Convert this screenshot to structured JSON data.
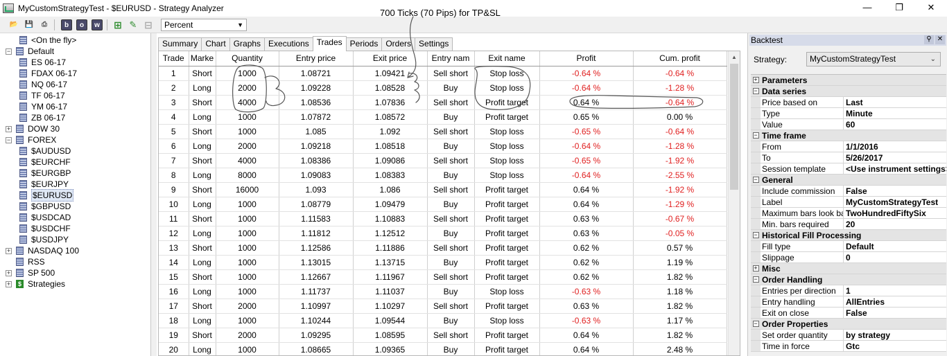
{
  "window": {
    "title": "MyCustomStrategyTest - $EURUSD - Strategy Analyzer"
  },
  "toolbar": {
    "bold_b": "b",
    "bold_o": "o",
    "bold_w": "w",
    "display_mode": "Percent"
  },
  "tree": {
    "items": [
      {
        "label": "<On the fly>",
        "level": 1,
        "expander": ""
      },
      {
        "label": "Default",
        "level": 0,
        "expander": "−"
      },
      {
        "label": "ES 06-17",
        "level": 1,
        "expander": ""
      },
      {
        "label": "FDAX 06-17",
        "level": 1,
        "expander": ""
      },
      {
        "label": "NQ 06-17",
        "level": 1,
        "expander": ""
      },
      {
        "label": "TF 06-17",
        "level": 1,
        "expander": ""
      },
      {
        "label": "YM 06-17",
        "level": 1,
        "expander": ""
      },
      {
        "label": "ZB 06-17",
        "level": 1,
        "expander": ""
      },
      {
        "label": "DOW 30",
        "level": 0,
        "expander": "+"
      },
      {
        "label": "FOREX",
        "level": 0,
        "expander": "−"
      },
      {
        "label": "$AUDUSD",
        "level": 1,
        "expander": ""
      },
      {
        "label": "$EURCHF",
        "level": 1,
        "expander": ""
      },
      {
        "label": "$EURGBP",
        "level": 1,
        "expander": ""
      },
      {
        "label": "$EURJPY",
        "level": 1,
        "expander": ""
      },
      {
        "label": "$EURUSD",
        "level": 1,
        "expander": "",
        "selected": true
      },
      {
        "label": "$GBPUSD",
        "level": 1,
        "expander": ""
      },
      {
        "label": "$USDCAD",
        "level": 1,
        "expander": ""
      },
      {
        "label": "$USDCHF",
        "level": 1,
        "expander": ""
      },
      {
        "label": "$USDJPY",
        "level": 1,
        "expander": ""
      },
      {
        "label": "NASDAQ 100",
        "level": 0,
        "expander": "+"
      },
      {
        "label": "RSS",
        "level": 0,
        "expander": ""
      },
      {
        "label": "SP 500",
        "level": 0,
        "expander": "+"
      },
      {
        "label": "Strategies",
        "level": 0,
        "expander": "+",
        "icon": "strategy"
      }
    ]
  },
  "tabs": [
    {
      "label": "Summary"
    },
    {
      "label": "Chart"
    },
    {
      "label": "Graphs"
    },
    {
      "label": "Executions"
    },
    {
      "label": "Trades",
      "active": true
    },
    {
      "label": "Periods"
    },
    {
      "label": "Orders"
    },
    {
      "label": "Settings"
    }
  ],
  "grid": {
    "columns": [
      "Trade",
      "Marke",
      "Quantity",
      "Entry price",
      "Exit price",
      "Entry nam",
      "Exit name",
      "Profit",
      "Cum. profit"
    ],
    "rows": [
      [
        "1",
        "Short",
        "1000",
        "1.08721",
        "1.09421",
        "Sell short",
        "Stop loss",
        "-0.64 %",
        "-0.64 %"
      ],
      [
        "2",
        "Long",
        "2000",
        "1.09228",
        "1.08528",
        "Buy",
        "Stop loss",
        "-0.64 %",
        "-1.28 %"
      ],
      [
        "3",
        "Short",
        "4000",
        "1.08536",
        "1.07836",
        "Sell short",
        "Profit target",
        "0.64 %",
        "-0.64 %"
      ],
      [
        "4",
        "Long",
        "1000",
        "1.07872",
        "1.08572",
        "Buy",
        "Profit target",
        "0.65 %",
        "0.00 %"
      ],
      [
        "5",
        "Short",
        "1000",
        "1.085",
        "1.092",
        "Sell short",
        "Stop loss",
        "-0.65 %",
        "-0.64 %"
      ],
      [
        "6",
        "Long",
        "2000",
        "1.09218",
        "1.08518",
        "Buy",
        "Stop loss",
        "-0.64 %",
        "-1.28 %"
      ],
      [
        "7",
        "Short",
        "4000",
        "1.08386",
        "1.09086",
        "Sell short",
        "Stop loss",
        "-0.65 %",
        "-1.92 %"
      ],
      [
        "8",
        "Long",
        "8000",
        "1.09083",
        "1.08383",
        "Buy",
        "Stop loss",
        "-0.64 %",
        "-2.55 %"
      ],
      [
        "9",
        "Short",
        "16000",
        "1.093",
        "1.086",
        "Sell short",
        "Profit target",
        "0.64 %",
        "-1.92 %"
      ],
      [
        "10",
        "Long",
        "1000",
        "1.08779",
        "1.09479",
        "Buy",
        "Profit target",
        "0.64 %",
        "-1.29 %"
      ],
      [
        "11",
        "Short",
        "1000",
        "1.11583",
        "1.10883",
        "Sell short",
        "Profit target",
        "0.63 %",
        "-0.67 %"
      ],
      [
        "12",
        "Long",
        "1000",
        "1.11812",
        "1.12512",
        "Buy",
        "Profit target",
        "0.63 %",
        "-0.05 %"
      ],
      [
        "13",
        "Short",
        "1000",
        "1.12586",
        "1.11886",
        "Sell short",
        "Profit target",
        "0.62 %",
        "0.57 %"
      ],
      [
        "14",
        "Long",
        "1000",
        "1.13015",
        "1.13715",
        "Buy",
        "Profit target",
        "0.62 %",
        "1.19 %"
      ],
      [
        "15",
        "Short",
        "1000",
        "1.12667",
        "1.11967",
        "Sell short",
        "Profit target",
        "0.62 %",
        "1.82 %"
      ],
      [
        "16",
        "Long",
        "1000",
        "1.11737",
        "1.11037",
        "Buy",
        "Stop loss",
        "-0.63 %",
        "1.18 %"
      ],
      [
        "17",
        "Short",
        "2000",
        "1.10997",
        "1.10297",
        "Sell short",
        "Profit target",
        "0.63 %",
        "1.82 %"
      ],
      [
        "18",
        "Long",
        "1000",
        "1.10244",
        "1.09544",
        "Buy",
        "Stop loss",
        "-0.63 %",
        "1.17 %"
      ],
      [
        "19",
        "Short",
        "2000",
        "1.09295",
        "1.08595",
        "Sell short",
        "Profit target",
        "0.64 %",
        "1.82 %"
      ],
      [
        "20",
        "Long",
        "1000",
        "1.08665",
        "1.09365",
        "Buy",
        "Profit target",
        "0.64 %",
        "2.48 %"
      ]
    ]
  },
  "annotation": {
    "text": "700 Ticks (70 Pips) for TP&SL"
  },
  "backtest": {
    "header": "Backtest",
    "strategy_label": "Strategy:",
    "strategy_value": "MyCustomStrategyTest",
    "properties": [
      {
        "type": "cat",
        "name": "Parameters",
        "expander": "+"
      },
      {
        "type": "cat",
        "name": "Data series",
        "expander": "−"
      },
      {
        "type": "prop",
        "name": "Price based on",
        "value": "Last"
      },
      {
        "type": "prop",
        "name": "Type",
        "value": "Minute"
      },
      {
        "type": "prop",
        "name": "Value",
        "value": "60"
      },
      {
        "type": "cat",
        "name": "Time frame",
        "expander": "−"
      },
      {
        "type": "prop",
        "name": "From",
        "value": "1/1/2016"
      },
      {
        "type": "prop",
        "name": "To",
        "value": "5/26/2017"
      },
      {
        "type": "prop",
        "name": "Session template",
        "value": "<Use instrument settings>"
      },
      {
        "type": "cat",
        "name": "General",
        "expander": "−"
      },
      {
        "type": "prop",
        "name": "Include commission",
        "value": "False"
      },
      {
        "type": "prop",
        "name": "Label",
        "value": "MyCustomStrategyTest"
      },
      {
        "type": "prop",
        "name": "Maximum bars look bac",
        "value": "TwoHundredFiftySix"
      },
      {
        "type": "prop",
        "name": "Min. bars required",
        "value": "20"
      },
      {
        "type": "cat",
        "name": "Historical Fill Processing",
        "expander": "−"
      },
      {
        "type": "prop",
        "name": "Fill type",
        "value": "Default"
      },
      {
        "type": "prop",
        "name": "Slippage",
        "value": "0"
      },
      {
        "type": "cat",
        "name": "Misc",
        "expander": "+"
      },
      {
        "type": "cat",
        "name": "Order Handling",
        "expander": "−"
      },
      {
        "type": "prop",
        "name": "Entries per direction",
        "value": "1"
      },
      {
        "type": "prop",
        "name": "Entry handling",
        "value": "AllEntries"
      },
      {
        "type": "prop",
        "name": "Exit on close",
        "value": "False"
      },
      {
        "type": "cat",
        "name": "Order Properties",
        "expander": "−"
      },
      {
        "type": "prop",
        "name": "Set order quantity",
        "value": "by strategy"
      },
      {
        "type": "prop",
        "name": "Time in force",
        "value": "Gtc"
      }
    ]
  },
  "colors": {
    "negative": "#e02020",
    "selection": "#dfe8f5",
    "panel_header": "#d6dbe9"
  }
}
